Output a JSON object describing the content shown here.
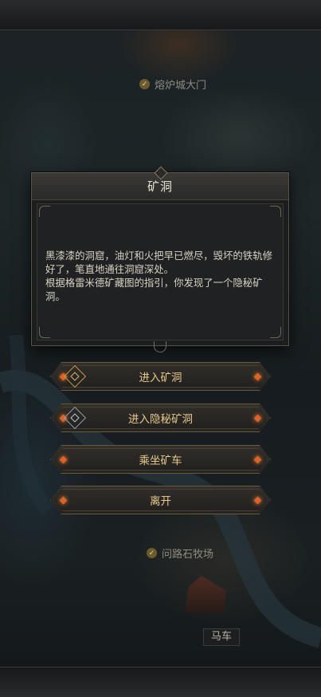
{
  "map": {
    "labels": {
      "furnace_gate": "熔炉城大门",
      "stone_ranch": "问路石牧场",
      "carriage": "马车"
    }
  },
  "dialog": {
    "title": "矿洞",
    "body_line1": "黑漆漆的洞窟，油灯和火把早已燃尽，毁坏的铁轨修好了，笔直地通往洞窟深处。",
    "body_line2": "根据格雷米德矿藏图的指引，你发现了一个隐秘矿洞。"
  },
  "options": [
    {
      "label": "进入矿洞",
      "icon": "mine-entrance-icon"
    },
    {
      "label": "进入隐秘矿洞",
      "icon": "secret-mine-icon"
    },
    {
      "label": "乘坐矿车"
    },
    {
      "label": "离开"
    }
  ],
  "colors": {
    "accent": "#e6c98b",
    "gem": "#d8642a",
    "dialog_bg": "#1c1d1e"
  }
}
